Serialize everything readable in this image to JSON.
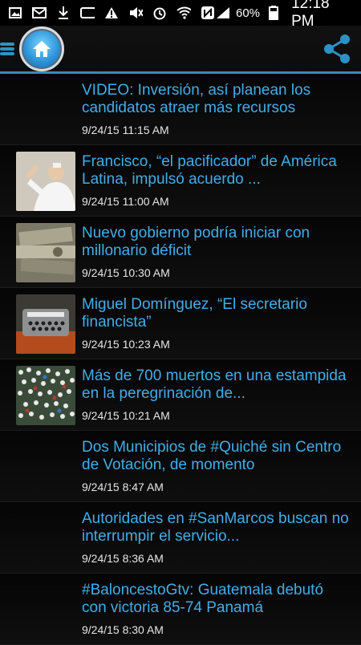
{
  "status": {
    "battery": "60%",
    "time": "12:18 PM"
  },
  "appbar": {
    "home_icon": "home-icon",
    "share_icon": "share-icon",
    "menu_icon": "menu-icon"
  },
  "articles": [
    {
      "title": "VIDEO: Inversión, así planean los candidatos atraer más recursos",
      "date": "9/24/15 11:15 AM",
      "thumb": ""
    },
    {
      "title": "Francisco, “el pacificador” de América Latina, impulsó acuerdo ...",
      "date": "9/24/15 11:00 AM",
      "thumb": "pope"
    },
    {
      "title": "Nuevo gobierno podría iniciar con millonario déficit",
      "date": "9/24/15 10:30 AM",
      "thumb": "money"
    },
    {
      "title": "Miguel Domínguez, “El secretario financista”",
      "date": "9/24/15 10:23 AM",
      "thumb": "typewriter"
    },
    {
      "title": "Más de 700 muertos en una estampida en la peregrinación de...",
      "date": "9/24/15 10:21 AM",
      "thumb": "crowd"
    },
    {
      "title": "Dos Municipios de #Quiché sin Centro de Votación, de momento",
      "date": "9/24/15 8:47 AM",
      "thumb": ""
    },
    {
      "title": "Autoridades en #SanMarcos buscan no interrumpir el servicio...",
      "date": "9/24/15 8:36 AM",
      "thumb": ""
    },
    {
      "title": "#BaloncestoGtv: Guatemala debutó con victoria 85-74 Panamá",
      "date": "9/24/15 8:30 AM",
      "thumb": ""
    }
  ],
  "colors": {
    "accent": "#41aee8",
    "divider": "#2c8fbf"
  }
}
